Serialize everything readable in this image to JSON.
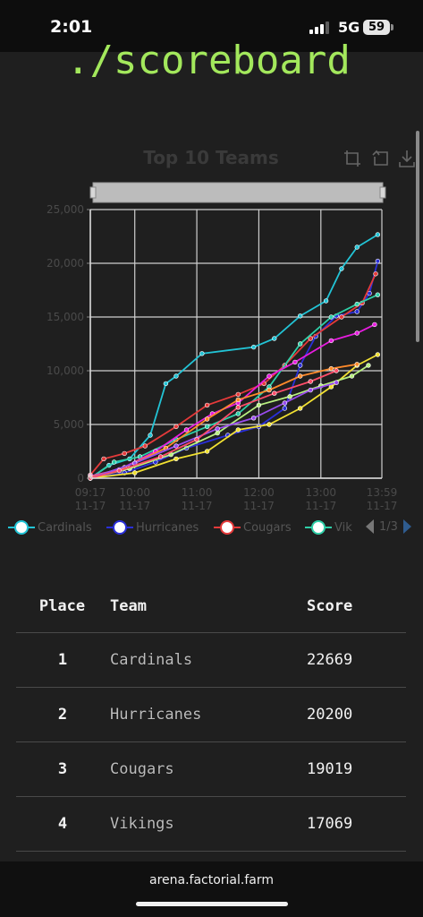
{
  "status": {
    "time": "2:01",
    "network": "5G",
    "battery": "59"
  },
  "page": {
    "heading": "./scoreboard"
  },
  "chart_data": {
    "type": "line",
    "title": "Top 10 Teams",
    "toolbox_icons": [
      "zoom-select-icon",
      "zoom-reset-icon",
      "download-icon"
    ],
    "x_axis_ticks": [
      {
        "time": "09:17",
        "date": "11-17"
      },
      {
        "time": "10:00",
        "date": "11-17"
      },
      {
        "time": "11:00",
        "date": "11-17"
      },
      {
        "time": "12:00",
        "date": "11-17"
      },
      {
        "time": "13:00",
        "date": "11-17"
      },
      {
        "time": "13:59",
        "date": "11-17"
      }
    ],
    "y_axis_ticks": [
      "0",
      "5,000",
      "10,000",
      "15,000",
      "20,000",
      "25,000"
    ],
    "ylim": [
      0,
      25000
    ],
    "xlim_minutes": [
      557,
      839
    ],
    "grid": true,
    "legend_page": "1/3",
    "legend": [
      {
        "name": "Cardinals",
        "color": "#22c4d6"
      },
      {
        "name": "Hurricanes",
        "color": "#2a2fd8"
      },
      {
        "name": "Cougars",
        "color": "#e53a3a"
      },
      {
        "name": "Vik",
        "color": "#2fcfa8"
      }
    ],
    "series": [
      {
        "name": "Cardinals",
        "color": "#22c4d6",
        "points": [
          [
            557,
            0
          ],
          [
            575,
            1200
          ],
          [
            595,
            1800
          ],
          [
            615,
            4000
          ],
          [
            630,
            8800
          ],
          [
            640,
            9500
          ],
          [
            665,
            11600
          ],
          [
            715,
            12200
          ],
          [
            735,
            13000
          ],
          [
            760,
            15100
          ],
          [
            785,
            16500
          ],
          [
            800,
            19500
          ],
          [
            815,
            21500
          ],
          [
            835,
            22669
          ]
        ]
      },
      {
        "name": "Hurricanes",
        "color": "#2a2fd8",
        "points": [
          [
            557,
            0
          ],
          [
            590,
            500
          ],
          [
            620,
            1500
          ],
          [
            650,
            2800
          ],
          [
            690,
            4000
          ],
          [
            720,
            4800
          ],
          [
            745,
            6500
          ],
          [
            760,
            10500
          ],
          [
            775,
            13200
          ],
          [
            795,
            15100
          ],
          [
            815,
            15500
          ],
          [
            827,
            17200
          ],
          [
            835,
            20200
          ]
        ]
      },
      {
        "name": "Cougars",
        "color": "#e53a3a",
        "points": [
          [
            557,
            300
          ],
          [
            570,
            1800
          ],
          [
            590,
            2300
          ],
          [
            610,
            3000
          ],
          [
            640,
            4800
          ],
          [
            670,
            6800
          ],
          [
            700,
            7800
          ],
          [
            725,
            8800
          ],
          [
            745,
            10500
          ],
          [
            770,
            13000
          ],
          [
            800,
            15000
          ],
          [
            820,
            16300
          ],
          [
            833,
            19019
          ]
        ]
      },
      {
        "name": "Vikings",
        "color": "#2fcfa8",
        "points": [
          [
            557,
            0
          ],
          [
            580,
            1500
          ],
          [
            605,
            2000
          ],
          [
            640,
            3600
          ],
          [
            670,
            4800
          ],
          [
            700,
            6000
          ],
          [
            730,
            8500
          ],
          [
            760,
            12500
          ],
          [
            790,
            15000
          ],
          [
            815,
            16200
          ],
          [
            835,
            17069
          ]
        ]
      },
      {
        "name": "",
        "color": "#e81ce0",
        "points": [
          [
            557,
            200
          ],
          [
            585,
            800
          ],
          [
            620,
            2500
          ],
          [
            650,
            4500
          ],
          [
            675,
            6000
          ],
          [
            700,
            7000
          ],
          [
            730,
            9500
          ],
          [
            755,
            10800
          ],
          [
            790,
            12800
          ],
          [
            815,
            13500
          ],
          [
            832,
            14300
          ]
        ]
      },
      {
        "name": "",
        "color": "#f2e132",
        "points": [
          [
            557,
            0
          ],
          [
            600,
            500
          ],
          [
            640,
            1800
          ],
          [
            670,
            2500
          ],
          [
            700,
            4500
          ],
          [
            730,
            5000
          ],
          [
            760,
            6500
          ],
          [
            790,
            8500
          ],
          [
            815,
            10500
          ],
          [
            835,
            11500
          ]
        ]
      },
      {
        "name": "",
        "color": "#ff8a2a",
        "points": [
          [
            557,
            100
          ],
          [
            590,
            1000
          ],
          [
            630,
            2800
          ],
          [
            670,
            5500
          ],
          [
            700,
            7300
          ],
          [
            730,
            8200
          ],
          [
            760,
            9500
          ],
          [
            790,
            10200
          ],
          [
            815,
            10600
          ]
        ]
      },
      {
        "name": "",
        "color": "#b8f080",
        "points": [
          [
            557,
            0
          ],
          [
            595,
            900
          ],
          [
            635,
            2200
          ],
          [
            680,
            4200
          ],
          [
            720,
            6800
          ],
          [
            750,
            7600
          ],
          [
            780,
            8600
          ],
          [
            810,
            9500
          ],
          [
            826,
            10500
          ]
        ]
      },
      {
        "name": "",
        "color": "#9a4cf0",
        "points": [
          [
            557,
            0
          ],
          [
            600,
            1400
          ],
          [
            640,
            3000
          ],
          [
            680,
            4600
          ],
          [
            715,
            5600
          ],
          [
            745,
            7000
          ],
          [
            770,
            8200
          ],
          [
            795,
            8900
          ]
        ]
      },
      {
        "name": "",
        "color": "#ff4d6a",
        "points": [
          [
            557,
            0
          ],
          [
            585,
            700
          ],
          [
            625,
            2000
          ],
          [
            660,
            3600
          ],
          [
            700,
            6600
          ],
          [
            735,
            7900
          ],
          [
            770,
            9000
          ],
          [
            795,
            10000
          ]
        ]
      }
    ]
  },
  "table": {
    "headers": {
      "place": "Place",
      "team": "Team",
      "score": "Score"
    },
    "rows": [
      {
        "place": "1",
        "team": "Cardinals",
        "score": "22669"
      },
      {
        "place": "2",
        "team": "Hurricanes",
        "score": "20200"
      },
      {
        "place": "3",
        "team": "Cougars",
        "score": "19019"
      },
      {
        "place": "4",
        "team": "Vikings",
        "score": "17069"
      }
    ]
  },
  "footer": {
    "url": "arena.factorial.farm"
  }
}
